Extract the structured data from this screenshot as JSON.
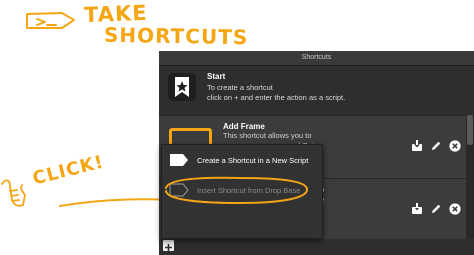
{
  "annotations": {
    "top_line1": "TAKE",
    "top_line2": "SHORTCUTS",
    "click_note": "CLICK!",
    "ink_color": "#f4a615"
  },
  "window": {
    "title": "Shortcuts"
  },
  "start": {
    "title": "Start",
    "line1": "To create a shortcut",
    "line2": "click on + and enter the action as a script."
  },
  "shortcuts": [
    {
      "title": "Add Frame",
      "desc_line1": "This shortcut allows you to",
      "desc_frag_a": "w",
      "desc_frag_b": "ered Gui"
    },
    {
      "frag_a": "o",
      "frag_b": "e"
    }
  ],
  "context_menu": {
    "items": [
      {
        "label": "Create a Shortcut in a New Script",
        "enabled": true
      },
      {
        "label": "Insert Shortcut from Drop Base",
        "enabled": false
      }
    ]
  },
  "icons": {
    "start": "bookmark-star-icon",
    "import": "import-icon",
    "edit": "pencil-icon",
    "delete": "close-circle-icon",
    "add": "plus-icon",
    "tag": "tag-icon"
  }
}
